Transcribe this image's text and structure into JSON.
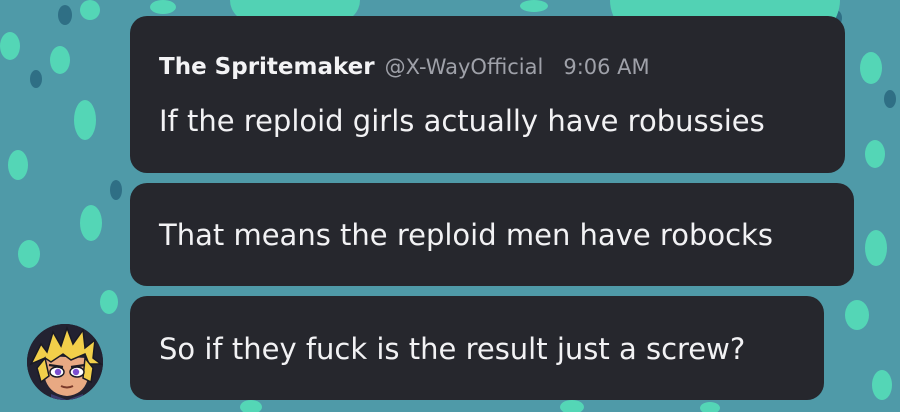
{
  "message_group": {
    "author": {
      "display_name": "The Spritemaker",
      "handle": "@X-WayOfficial",
      "avatar": "avatar-cartoon-face-icon"
    },
    "timestamp": "9:06 AM",
    "messages": [
      {
        "text": "If the reploid girls actually have robussies"
      },
      {
        "text": "That means the reploid men have robocks"
      },
      {
        "text": "So if they fuck is the result just a screw?"
      }
    ]
  },
  "colors": {
    "bubble_bg": "#26272d",
    "text_primary": "#f2f2f4",
    "text_secondary": "#9fa1a9",
    "background": "#4f9aa8",
    "background_pattern": "#54d6b6"
  }
}
